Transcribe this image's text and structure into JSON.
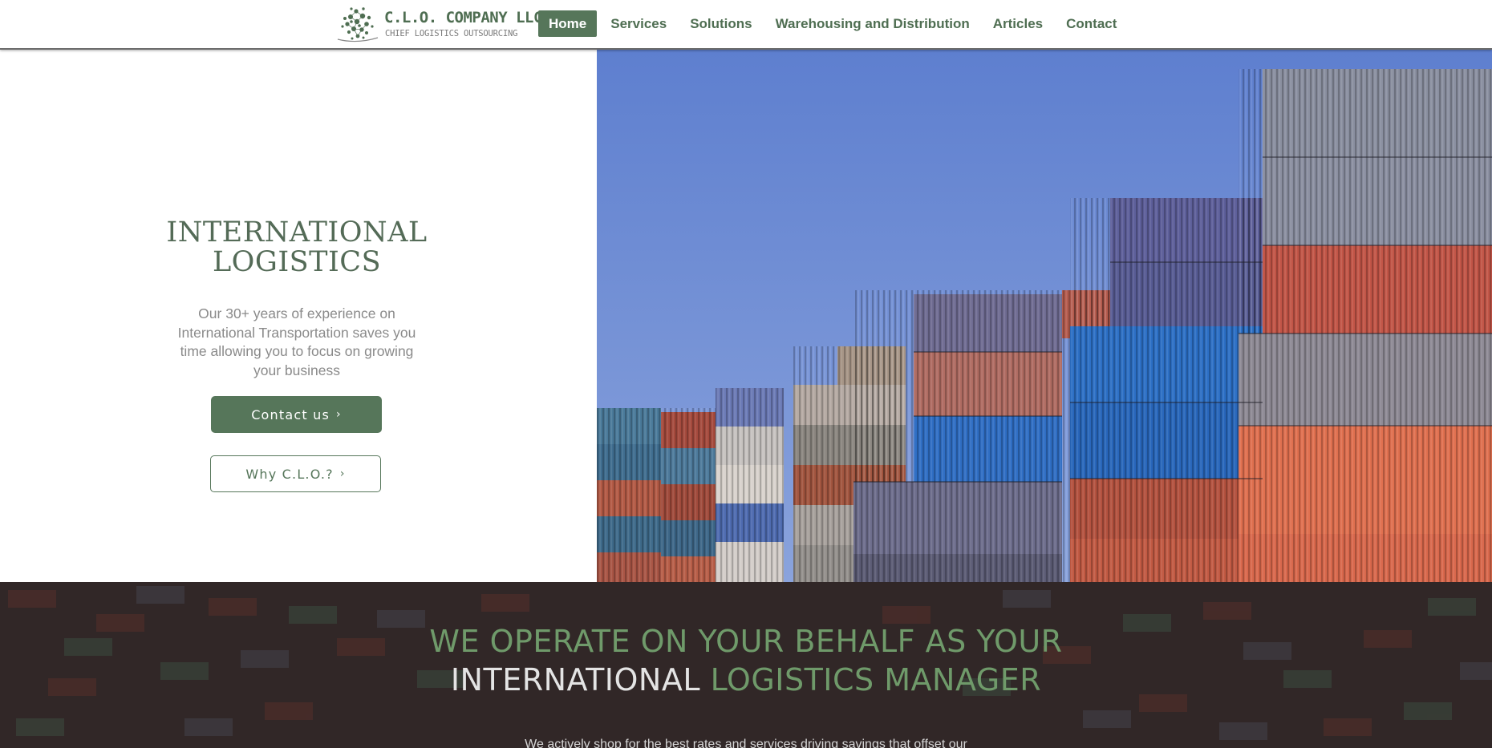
{
  "header": {
    "logo": {
      "name": "C.L.O. COMPANY LLC",
      "tagline": "CHIEF LOGISTICS OUTSOURCING",
      "icon": "globe-dots-icon"
    },
    "nav": [
      {
        "label": "Home",
        "active": true
      },
      {
        "label": "Services",
        "active": false
      },
      {
        "label": "Solutions",
        "active": false
      },
      {
        "label": "Warehousing and Distribution",
        "active": false
      },
      {
        "label": "Articles",
        "active": false
      },
      {
        "label": "Contact",
        "active": false
      }
    ]
  },
  "hero": {
    "title_line1": "INTERNATIONAL",
    "title_line2": "LOGISTICS",
    "description": "Our 30+ years of experience on International Transportation saves you time allowing you to focus on growing your business",
    "primary_button": "Contact us",
    "secondary_button": "Why C.L.O.?",
    "button_chevron": "›",
    "image": "shipping-containers-photo"
  },
  "band": {
    "title_part1": "WE OPERATE ON YOUR BEHALF AS YOUR",
    "title_part2": "INTERNATIONAL",
    "title_part3": "LOGISTICS MANAGER",
    "subtitle": "We actively shop for the best rates and services driving savings that offset our",
    "image": "container-yard-aerial-photo"
  },
  "colors": {
    "brand_green": "#56765a",
    "title_green": "#546b57",
    "sky_blue": "#6f8ed3",
    "band_dark": "#2b2526"
  }
}
